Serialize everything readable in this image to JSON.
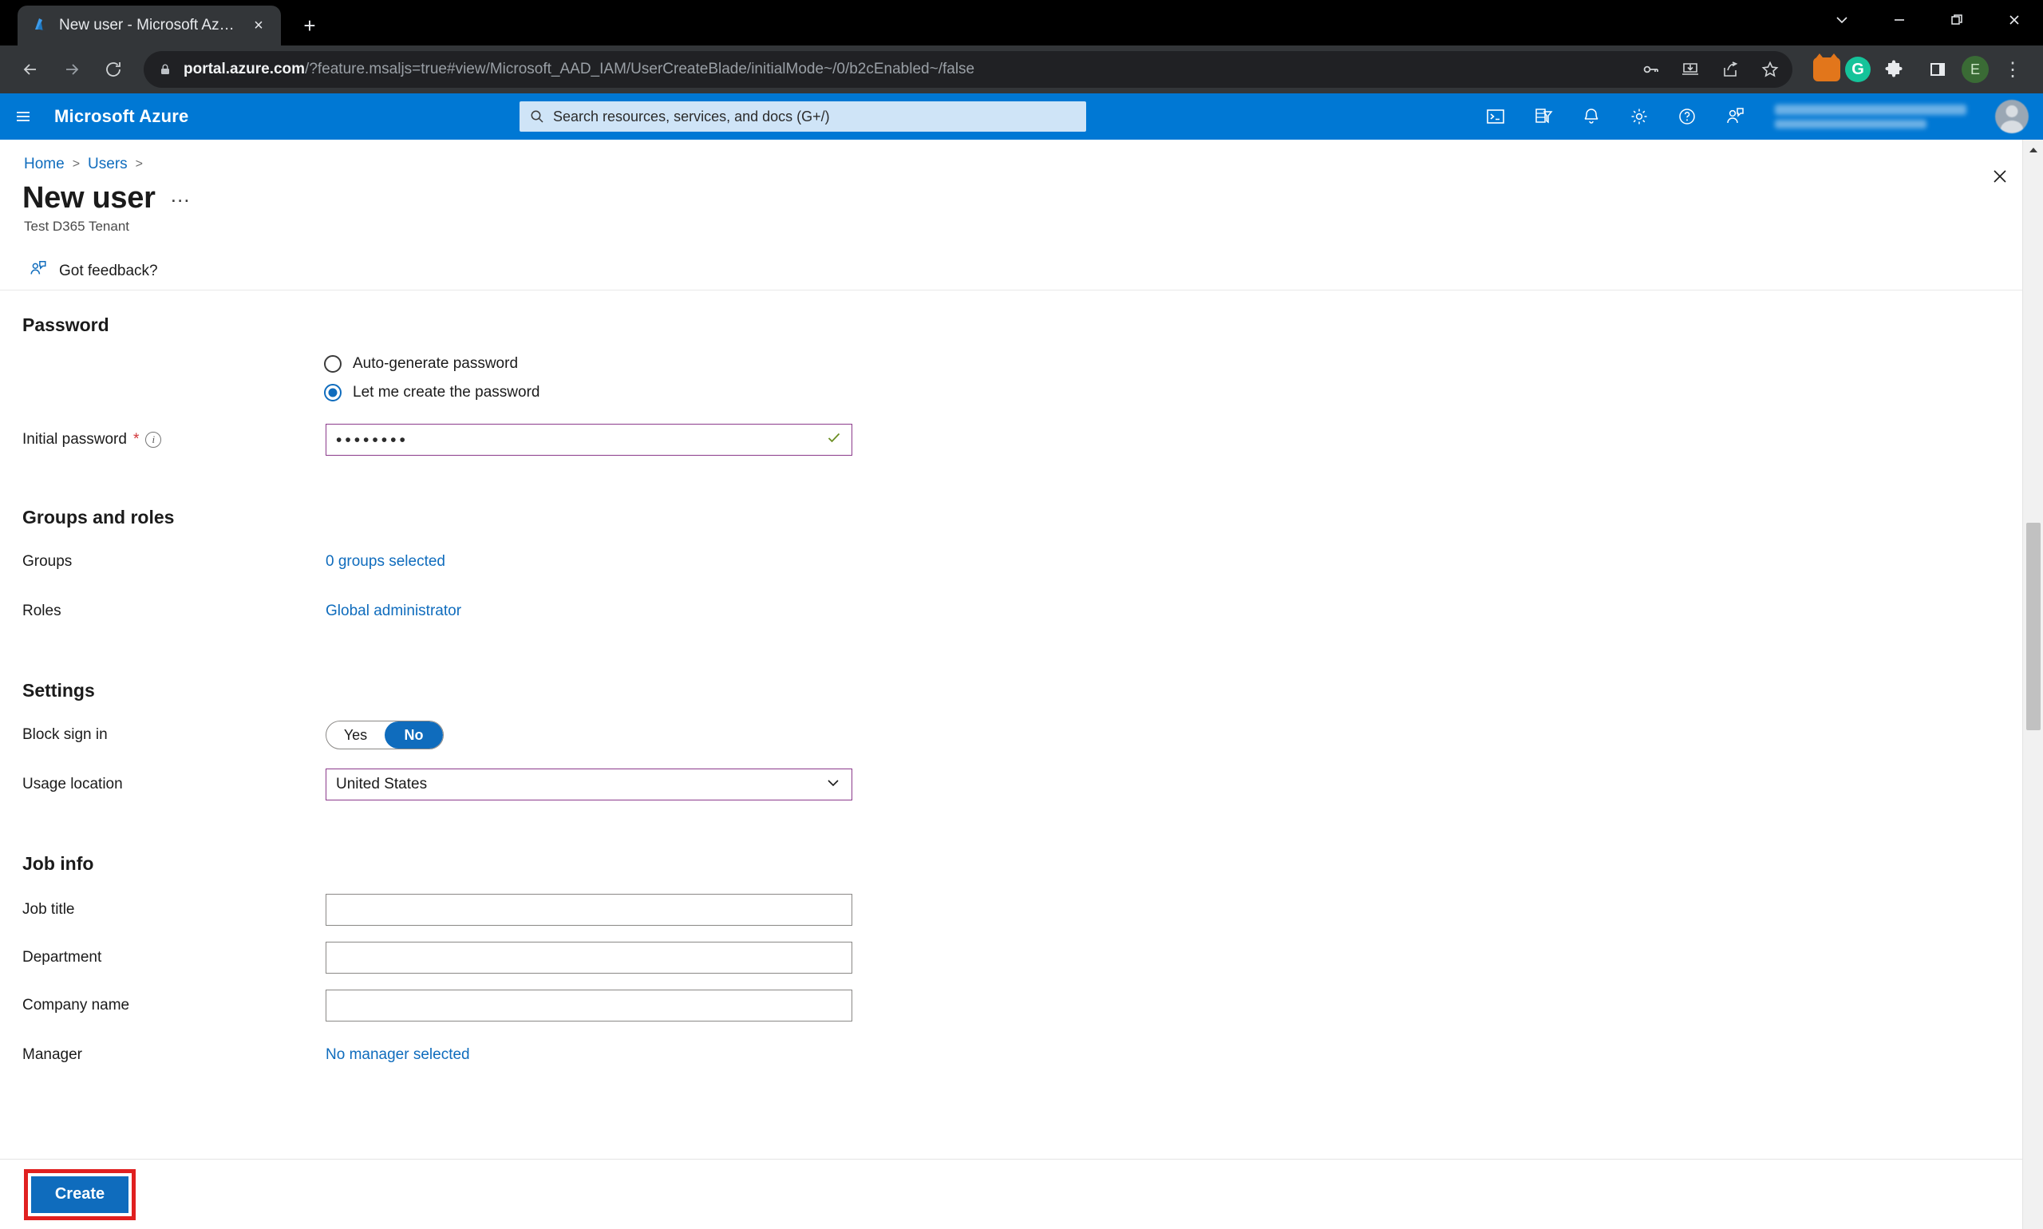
{
  "browser": {
    "tab": {
      "title": "New user - Microsoft Azure",
      "favicon": "azure-logo-icon",
      "close": "×"
    },
    "new_tab_label": "+",
    "window_controls": {
      "minimize_more": "chevron-down-icon",
      "minimize": "—",
      "maximize": "□",
      "close": "✕"
    },
    "nav": {
      "back": "←",
      "forward": "→",
      "reload": "⟳"
    },
    "url_bold": "portal.azure.com",
    "url_rest": "/?feature.msaljs=true#view/Microsoft_AAD_IAM/UserCreateBlade/initialMode~/0/b2cEnabled~/false",
    "toolbar_icons": [
      "key-icon",
      "install-app-icon",
      "share-icon",
      "bookmark-star-icon"
    ],
    "extensions": [
      "metamask-fox-icon",
      "grammarly-icon",
      "puzzle-extensions-icon",
      "side-panel-icon"
    ],
    "grammarly_letter": "G",
    "profile_letter": "E",
    "menu": "⋮"
  },
  "azure_header": {
    "menu_icon": "hamburger-icon",
    "brand": "Microsoft Azure",
    "search_placeholder": "Search resources, services, and docs (G+/)",
    "icons": [
      "cloud-shell-icon",
      "directories-subscriptions-icon",
      "notifications-bell-icon",
      "settings-gear-icon",
      "help-question-icon",
      "feedback-icon"
    ],
    "accent": "#0078d4"
  },
  "blade": {
    "breadcrumb": [
      "Home",
      "Users"
    ],
    "breadcrumb_separator": ">",
    "title": "New user",
    "more_actions": "…",
    "subtitle": "Test D365 Tenant",
    "close_label": "✕",
    "feedback_label": "Got feedback?"
  },
  "sections": {
    "password": {
      "heading": "Password",
      "options": [
        {
          "label": "Auto-generate password",
          "selected": false
        },
        {
          "label": "Let me create the password",
          "selected": true
        }
      ],
      "initial_password": {
        "label": "Initial password",
        "required_marker": "*",
        "info": "i",
        "value": "••••••••",
        "validated": true,
        "border_color": "#8b3a8b",
        "check_color": "#6b8e23"
      }
    },
    "groups_roles": {
      "heading": "Groups and roles",
      "groups_label": "Groups",
      "groups_value": "0 groups selected",
      "roles_label": "Roles",
      "roles_value": "Global administrator"
    },
    "settings": {
      "heading": "Settings",
      "block_sign_in_label": "Block sign in",
      "block_sign_in_options": [
        "Yes",
        "No"
      ],
      "block_sign_in_selected": "No",
      "usage_location_label": "Usage location",
      "usage_location_value": "United States"
    },
    "job_info": {
      "heading": "Job info",
      "fields": [
        {
          "label": "Job title",
          "value": "",
          "placeholder": ""
        },
        {
          "label": "Department",
          "value": "",
          "placeholder": ""
        },
        {
          "label": "Company name",
          "value": "",
          "placeholder": ""
        }
      ],
      "manager_label": "Manager",
      "manager_value": "No manager selected"
    }
  },
  "footer": {
    "create_label": "Create",
    "highlight_color": "#e02020",
    "button_color": "#0f6cbd"
  }
}
